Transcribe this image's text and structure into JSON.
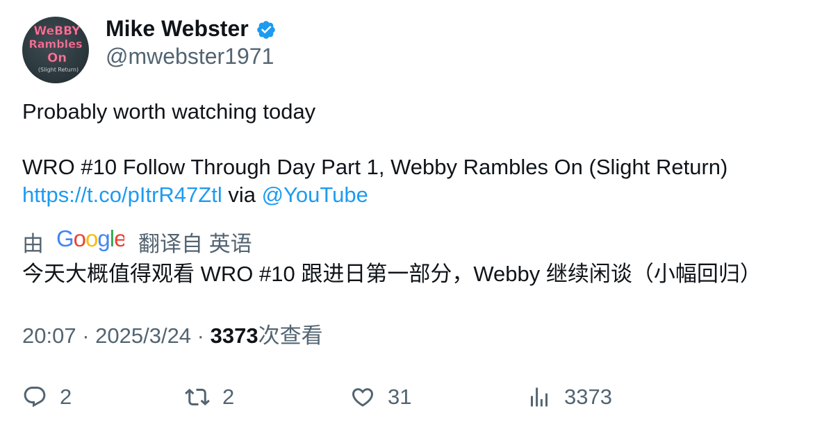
{
  "user": {
    "display_name": "Mike Webster",
    "handle": "@mwebster1971",
    "verified": true,
    "avatar_text": [
      "WeBBY",
      "Rambles",
      "On",
      "(Slight Return)"
    ]
  },
  "tweet": {
    "line1": "Probably worth watching today",
    "line2": "WRO #10 Follow Through Day Part 1, Webby Rambles On (Slight Return)",
    "link": "https://t.co/pItrR47Ztl",
    "via": " via ",
    "mention": "@YouTube"
  },
  "translation": {
    "prefix": "由",
    "provider": "Google",
    "suffix": "翻译自 英语",
    "text": "今天大概值得观看 WRO #10 跟进日第一部分，Webby 继续闲谈（小幅回归）"
  },
  "meta": {
    "time": "20:07",
    "sep1": " · ",
    "date": "2025/3/24",
    "sep2": " · ",
    "views": "3373",
    "views_label": "次查看"
  },
  "actions": {
    "replies": "2",
    "reposts": "2",
    "likes": "31",
    "views": "3373"
  },
  "colors": {
    "link": "#1d9bf0",
    "verified": "#1d9bf0",
    "secondary_text": "#536471",
    "primary_text": "#0f1419",
    "avatar_text": "#f07a9b"
  }
}
